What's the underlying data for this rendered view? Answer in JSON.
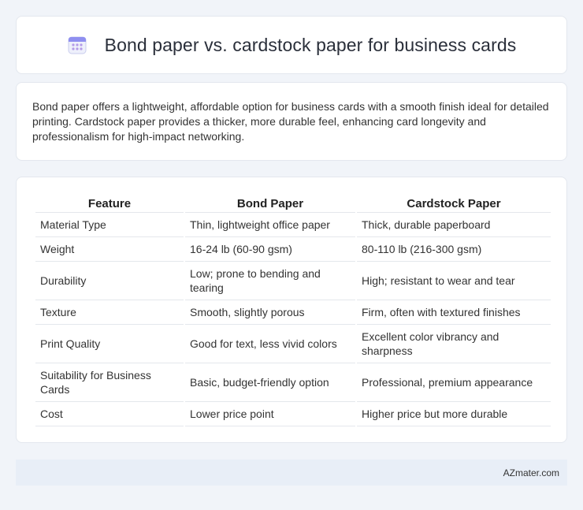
{
  "header": {
    "icon": "calendar-icon",
    "title": "Bond paper vs. cardstock paper for business cards"
  },
  "intro": {
    "text": "Bond paper offers a lightweight, affordable option for business cards with a smooth finish ideal for detailed printing. Cardstock paper provides a thicker, more durable feel, enhancing card longevity and professionalism for high-impact networking."
  },
  "table": {
    "headers": [
      "Feature",
      "Bond Paper",
      "Cardstock Paper"
    ],
    "rows": [
      [
        "Material Type",
        "Thin, lightweight office paper",
        "Thick, durable paperboard"
      ],
      [
        "Weight",
        "16-24 lb (60-90 gsm)",
        "80-110 lb (216-300 gsm)"
      ],
      [
        "Durability",
        "Low; prone to bending and tearing",
        "High; resistant to wear and tear"
      ],
      [
        "Texture",
        "Smooth, slightly porous",
        "Firm, often with textured finishes"
      ],
      [
        "Print Quality",
        "Good for text, less vivid colors",
        "Excellent color vibrancy and sharpness"
      ],
      [
        "Suitability for Business Cards",
        "Basic, budget-friendly option",
        "Professional, premium appearance"
      ],
      [
        "Cost",
        "Lower price point",
        "Higher price but more durable"
      ]
    ]
  },
  "footer": {
    "site": "AZmater.com"
  },
  "colors": {
    "page_bg": "#f1f4f9",
    "card_bg": "#ffffff",
    "footer_bg": "#e8eef7",
    "icon_accent": "#9a7fe0"
  }
}
